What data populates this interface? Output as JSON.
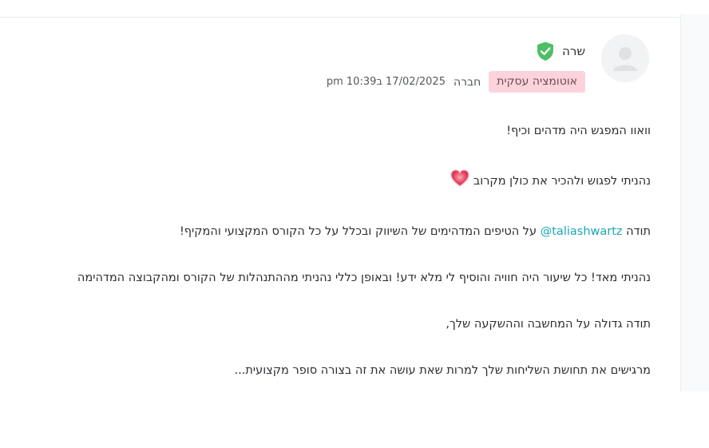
{
  "post": {
    "author_name": "שרה",
    "tag": "אוטומציה עסקית",
    "role": "חברה",
    "date": "17/02/2025 ב10:39 pm",
    "paragraphs": {
      "p1": "וואוו המפגש היה מדהים וכיף!",
      "p2": "נהניתי לפגוש ולהכיר את כולן מקרוב",
      "p3_before": "תודה ",
      "p3_mention": "@taliashwartz",
      "p3_after": " על הטיפים המדהימים של השיווק ובכלל על כל הקורס המקצועי והמקיף!",
      "p4": "נהניתי מאד! כל שיעור היה חוויה והוסיף לי מלא ידע! ובאופן כללי נהניתי מההתנהלות של הקורס ומהקבוצה המדהימה",
      "p5": "תודה גדולה על המחשבה וההשקעה שלך,",
      "p6": "מרגישים את תחושת השליחות שלך למרות שאת עושה את זה בצורה סופר מקצועית..."
    }
  },
  "icons": {
    "verified": "shield-check-icon",
    "heart": "heart-icon",
    "avatar": "user-avatar-icon"
  },
  "colors": {
    "verified_green": "#4cbf63",
    "tag_background": "#fbd3dd",
    "mention": "#1aa5b6",
    "heart": "#e8405c"
  }
}
